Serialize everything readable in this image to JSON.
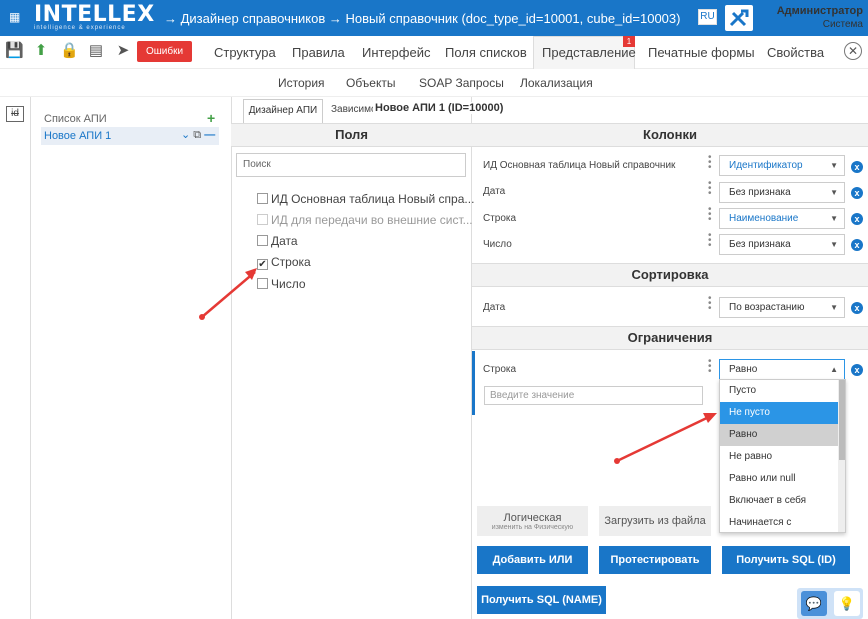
{
  "app": {
    "logo_text": "INTELLEX",
    "logo_sub": "intelligence & experience",
    "breadcrumb": "→ Дизайнер справочников  → Новый справочник (doc_type_id=10001, cube_id=10003)",
    "lang": "RU",
    "user_name": "Администратор",
    "user_role": "Система"
  },
  "toolbar": {
    "errors_label": "Ошибки",
    "tabs": [
      "Структура",
      "Правила",
      "Интерфейс",
      "Поля списков",
      "Представление",
      "Печатные формы",
      "Свойства"
    ],
    "active_tab": "Представление",
    "badge": "1"
  },
  "subtabs": [
    "История",
    "Объекты",
    "SOAP Запросы",
    "Локализация"
  ],
  "sidebar": {
    "id_icon": "id",
    "list_label": "Список АПИ",
    "add_label": "+",
    "api_item": "Новое АПИ 1"
  },
  "center": {
    "tab_designer": "Дизайнер АПИ",
    "tab_deps": "Зависимости",
    "api_title": "Новое АПИ 1 (ID=10000)",
    "fields_header": "Поля",
    "search_placeholder": "Поиск",
    "fields": [
      {
        "label": "ИД Основная таблица Новый спра...",
        "checked": false,
        "dim": false
      },
      {
        "label": "ИД для передачи во внешние сист...",
        "checked": false,
        "dim": true
      },
      {
        "label": "Дата",
        "checked": false,
        "dim": false
      },
      {
        "label": "Строка",
        "checked": true,
        "dim": false
      },
      {
        "label": "Число",
        "checked": false,
        "dim": false
      }
    ]
  },
  "right": {
    "columns_header": "Колонки",
    "columns": [
      {
        "label": "ИД Основная таблица Новый справочник",
        "value": "Идентификатор"
      },
      {
        "label": "Дата",
        "value": "Без признака"
      },
      {
        "label": "Строка",
        "value": "Наименование"
      },
      {
        "label": "Число",
        "value": "Без признака"
      }
    ],
    "sort_header": "Сортировка",
    "sort": {
      "label": "Дата",
      "value": "По возрастанию"
    },
    "constraints_header": "Ограничения",
    "constraint": {
      "label": "Строка",
      "value": "Равно",
      "input_placeholder": "Введите значение"
    },
    "dropdown_options": [
      "Пусто",
      "Не пусто",
      "Равно",
      "Не равно",
      "Равно или null",
      "Включает в себя",
      "Начинается с"
    ],
    "highlighted_option": "Не пусто",
    "selected_option": "Равно",
    "btn_logic": "Логическая",
    "btn_logic_sub": "изменить на Физическую",
    "btn_upload": "Загрузить из файла",
    "btn_add_or": "Добавить ИЛИ",
    "btn_test": "Протестировать",
    "btn_sql_id": "Получить SQL (ID)",
    "btn_sql_name": "Получить SQL (NAME)"
  },
  "colors": {
    "accent": "#1976c8",
    "error": "#e53935",
    "annotation": "#e53935"
  }
}
